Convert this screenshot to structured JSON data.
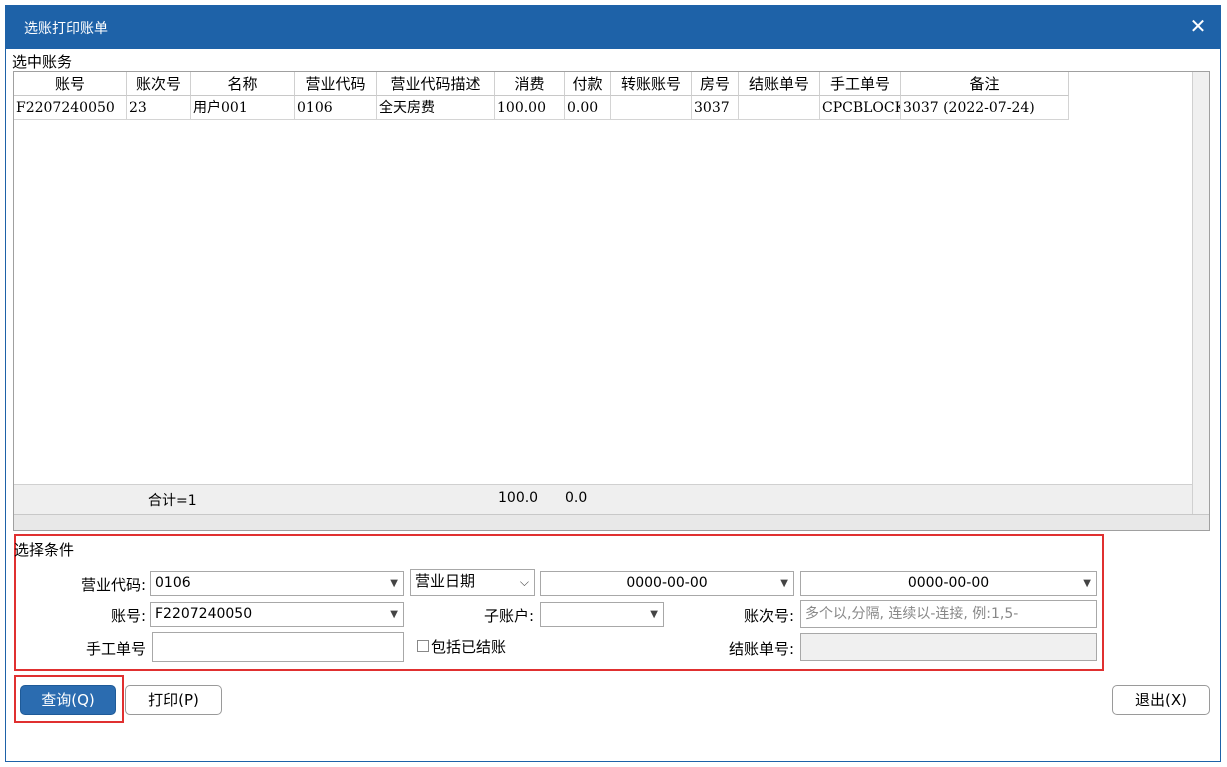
{
  "window": {
    "title": "选账打印账单"
  },
  "selected_section": "选中账务",
  "table": {
    "columns": [
      "账号",
      "账次号",
      "名称",
      "营业代码",
      "营业代码描述",
      "消费",
      "付款",
      "转账账号",
      "房号",
      "结账单号",
      "手工单号",
      "备注"
    ],
    "rows": [
      [
        "F2207240050",
        "23",
        "用户001",
        "0106",
        "全天房费",
        "100.00",
        "0.00",
        "",
        "3037",
        "",
        "CPCBLOCK",
        "3037 (2022-07-24)"
      ]
    ],
    "footer": {
      "count_label": "合计=1",
      "consume_total": "100.0",
      "payment_total": "0.0"
    }
  },
  "criteria": {
    "section_label": "选择条件",
    "business_code_label": "营业代码:",
    "business_code_value": "0106",
    "date_type_value": "营业日期",
    "date_from": "0000-00-00",
    "date_to": "0000-00-00",
    "account_label": "账号:",
    "account_value": "F2207240050",
    "sub_account_label": "子账户:",
    "sub_account_value": "",
    "seq_label": "账次号:",
    "seq_placeholder": "多个以,分隔, 连续以-连接, 例:1,5-",
    "manual_no_label": "手工单号",
    "manual_no_value": "",
    "include_settled_label": "包括已结账",
    "checkout_no_label": "结账单号:",
    "checkout_no_value": ""
  },
  "buttons": {
    "query": "查询(Q)",
    "print": "打印(P)",
    "exit": "退出(X)"
  },
  "colors": {
    "title_bar": "#1e62a8",
    "highlight": "#e03030",
    "primary_button": "#2b6cb0"
  }
}
